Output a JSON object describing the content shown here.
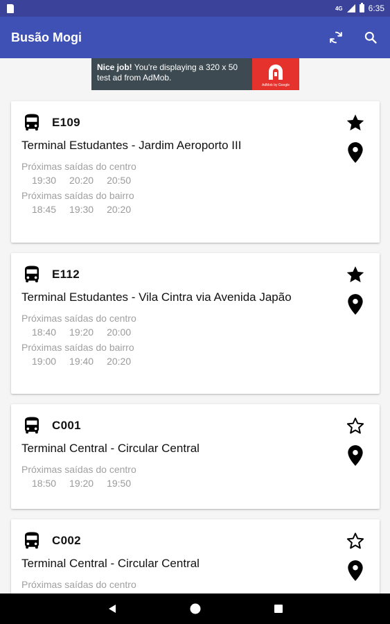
{
  "status_bar": {
    "network": "4G",
    "time": "6:35"
  },
  "app_bar": {
    "title": "Busão Mogi",
    "refresh_icon": "refresh-icon",
    "search_icon": "search-icon"
  },
  "ad": {
    "bold": "Nice job!",
    "text": " You're displaying a 320 x 50 test ad from AdMob.",
    "brand": "AdMob by Google"
  },
  "cards": [
    {
      "code": "E109",
      "route": "Terminal Estudantes - Jardim Aeroporto III",
      "favorite": true,
      "center_label": "Próximas saídas do centro",
      "center_times": [
        "19:30",
        "20:20",
        "20:50"
      ],
      "neighborhood_label": "Próximas saídas do bairro",
      "neighborhood_times": [
        "18:45",
        "19:30",
        "20:20"
      ]
    },
    {
      "code": "E112",
      "route": "Terminal Estudantes - Vila Cintra via Avenida Japão",
      "favorite": true,
      "center_label": "Próximas saídas do centro",
      "center_times": [
        "18:40",
        "19:20",
        "20:00"
      ],
      "neighborhood_label": "Próximas saídas do bairro",
      "neighborhood_times": [
        "19:00",
        "19:40",
        "20:20"
      ]
    },
    {
      "code": "C001",
      "route": "Terminal Central - Circular Central",
      "favorite": false,
      "center_label": "Próximas saídas do centro",
      "center_times": [
        "18:50",
        "19:20",
        "19:50"
      ]
    },
    {
      "code": "C002",
      "route": "Terminal Central - Circular Central",
      "favorite": false,
      "center_label": "Próximas saídas do centro"
    }
  ],
  "colors": {
    "primary": "#3f51b5",
    "primary_dark": "#3a4399",
    "ad_background": "#3d4a52",
    "ad_logo": "#e5322d"
  }
}
